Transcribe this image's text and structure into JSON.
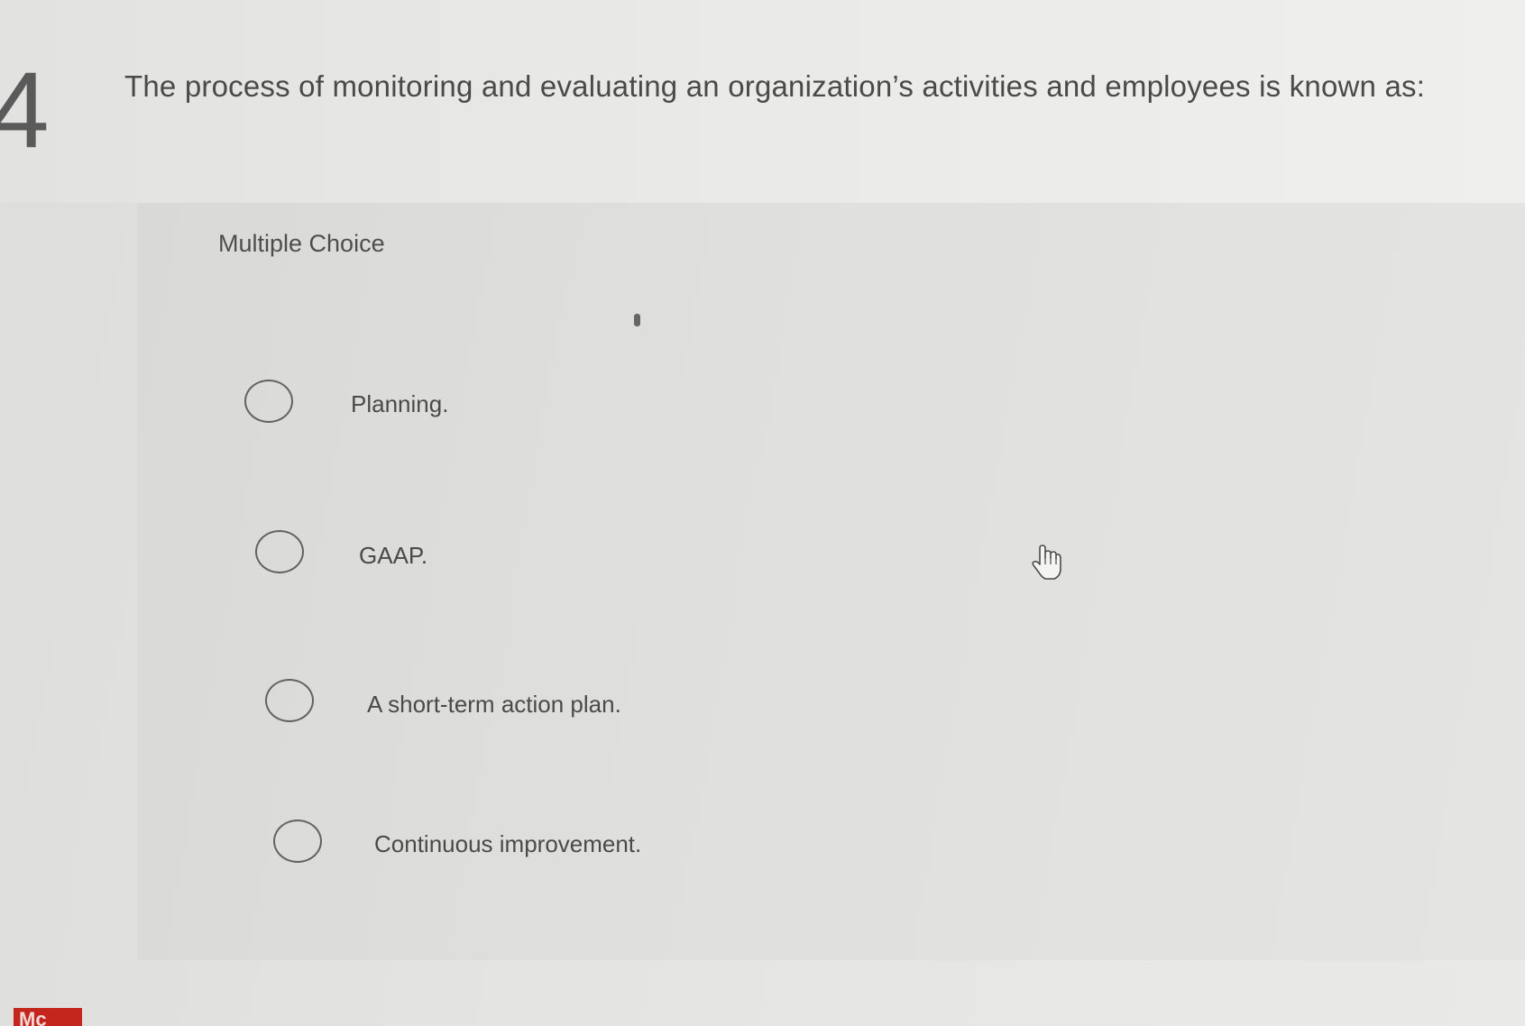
{
  "question": {
    "number": "4",
    "text": "The process of monitoring and evaluating an organization’s activities and employees is known as:"
  },
  "section_label": "Multiple Choice",
  "options": [
    {
      "label": "Planning.",
      "selected": false
    },
    {
      "label": "GAAP.",
      "selected": false
    },
    {
      "label": "A short-term action plan.",
      "selected": false
    },
    {
      "label": "Continuous improvement.",
      "selected": false
    }
  ],
  "brand": {
    "text": "Mc",
    "color": "#c4261d"
  },
  "icons": {
    "cursor": "hand-pointer-icon",
    "radio": "radio-circle-icon"
  }
}
